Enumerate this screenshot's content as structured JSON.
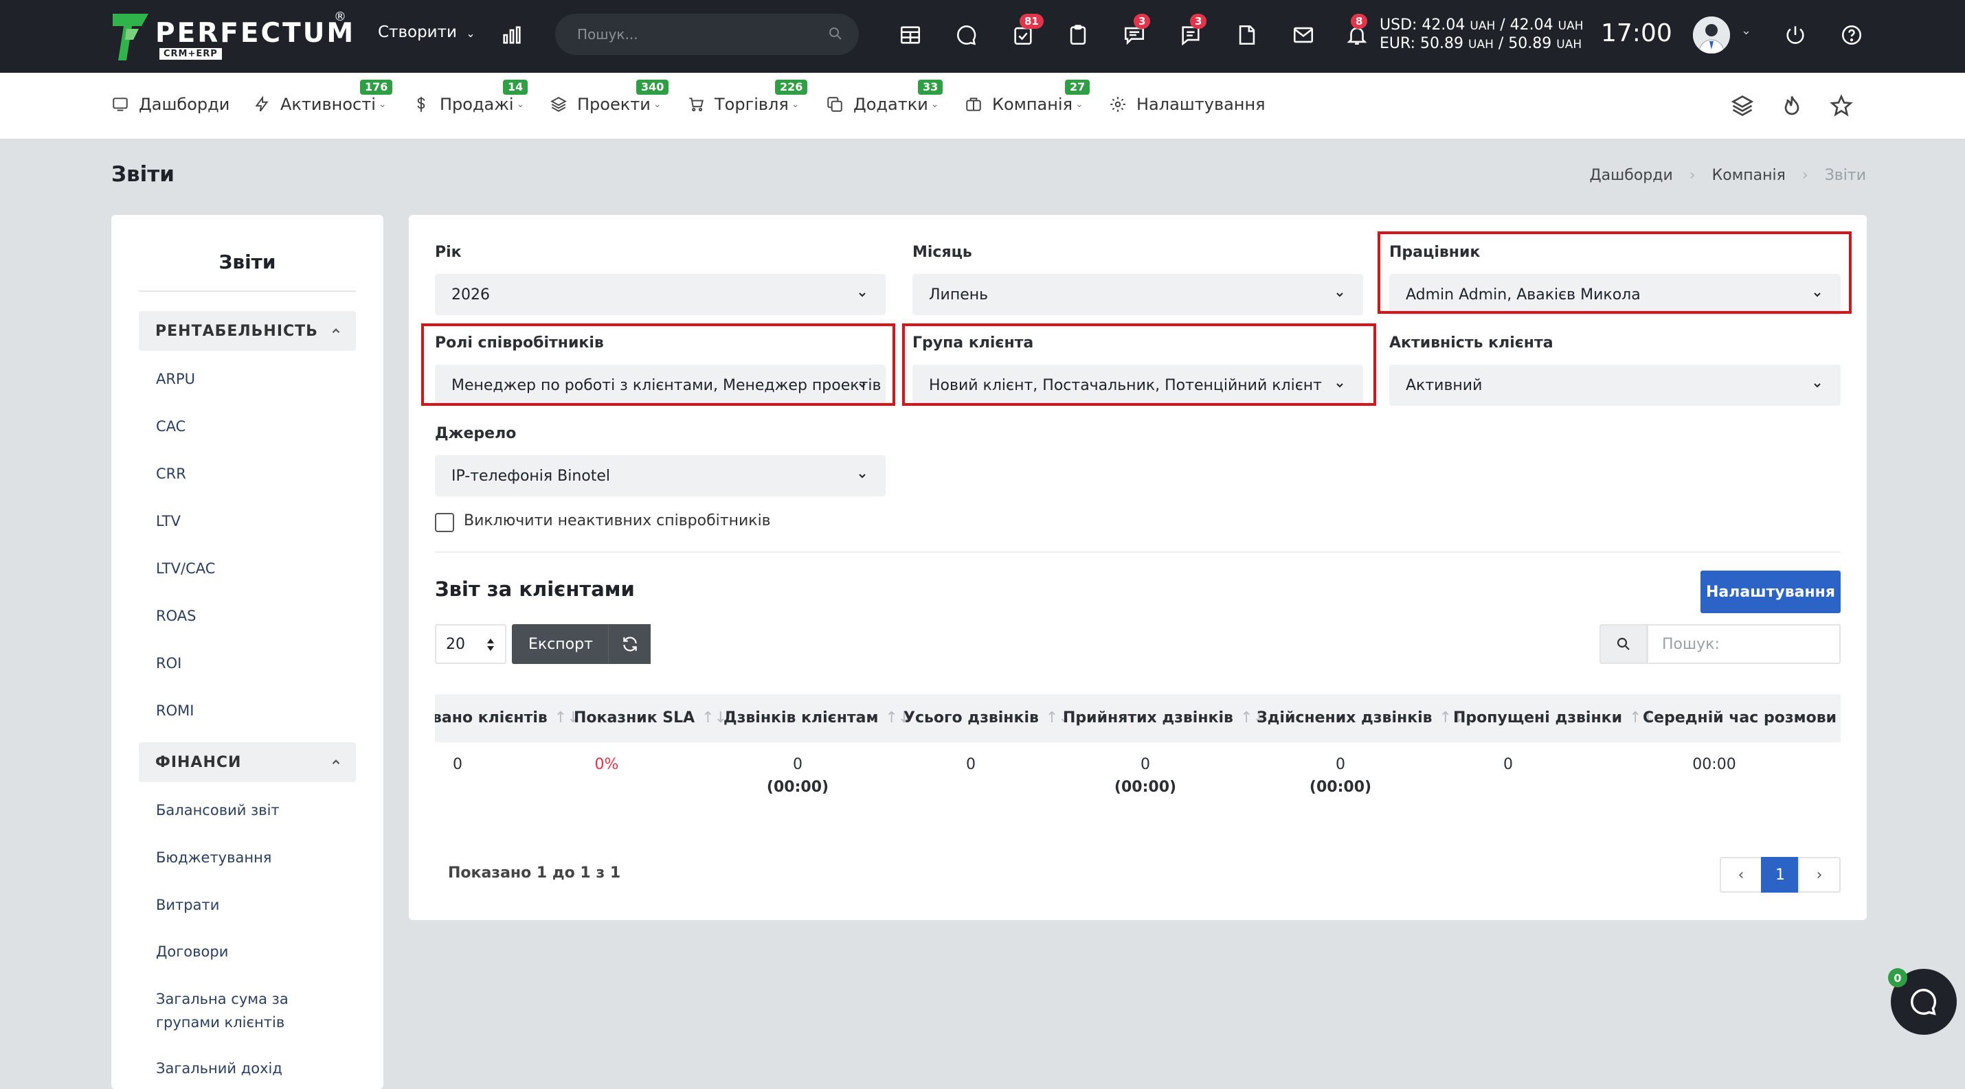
{
  "header": {
    "logo_text": "PERFECTUM",
    "logo_reg": "®",
    "logo_sub": "CRM+ERP",
    "create_label": "Створити",
    "search_placeholder": "Пошук...",
    "badges": {
      "tasks": "81",
      "chat": "3",
      "comments": "3",
      "notifications": "8"
    },
    "currency_usd": "USD: 42.04",
    "currency_usd_unit1": "UAH",
    "currency_usd_sep": " / 42.04",
    "currency_usd_unit2": "UAH",
    "currency_eur": "EUR: 50.89",
    "currency_eur_unit1": "UAH",
    "currency_eur_sep": " / 50.89",
    "currency_eur_unit2": "UAH",
    "clock": "17:00",
    "icons": [
      "bar-chart-icon",
      "calendar-grid-icon",
      "chat-bubble-icon",
      "task-check-icon",
      "clipboard-icon",
      "comments-icon",
      "message-icon",
      "document-icon",
      "mail-icon",
      "bell-icon",
      "power-icon",
      "help-icon"
    ]
  },
  "nav": {
    "items": [
      {
        "label": "Дашборди",
        "count": "",
        "icon": "dashboard-icon"
      },
      {
        "label": "Активності",
        "count": "176",
        "icon": "lightning-icon"
      },
      {
        "label": "Продажі",
        "count": "14",
        "icon": "dollar-icon"
      },
      {
        "label": "Проекти",
        "count": "340",
        "icon": "layers-icon"
      },
      {
        "label": "Торгівля",
        "count": "226",
        "icon": "cart-icon"
      },
      {
        "label": "Додатки",
        "count": "33",
        "icon": "copy-icon"
      },
      {
        "label": "Компанія",
        "count": "27",
        "icon": "briefcase-icon"
      },
      {
        "label": "Налаштування",
        "count": "",
        "icon": "gear-icon"
      }
    ]
  },
  "page": {
    "title": "Звіти",
    "breadcrumb": [
      "Дашборди",
      "Компанія",
      "Звіти"
    ]
  },
  "sidebar": {
    "title": "Звіти",
    "section1": "РЕНТАБЕЛЬНІСТЬ",
    "section1_items": [
      "ARPU",
      "CAC",
      "CRR",
      "LTV",
      "LTV/CAC",
      "ROAS",
      "ROI",
      "ROMI"
    ],
    "section2": "ФІНАНСИ",
    "section2_items": [
      "Балансовий звіт",
      "Бюджетування",
      "Витрати",
      "Договори",
      "Загальна сума за",
      "групами клієнтів",
      "Загальний дохід"
    ]
  },
  "filters": {
    "year_label": "Рік",
    "year_value": "2026",
    "month_label": "Місяць",
    "month_value": "Липень",
    "employee_label": "Працівник",
    "employee_value": "Admin Admin, Авакієв Микола",
    "roles_label": "Ролі співробітників",
    "roles_value": "Менеджер по роботі з клієнтами, Менеджер проектів",
    "group_label": "Група клієнта",
    "group_value": "Новий клієнт, Постачальник, Потенційний клієнт, Підрядник",
    "activity_label": "Активність клієнта",
    "activity_value": "Активний",
    "source_label": "Джерело",
    "source_value": "IP-телефонія Binotel",
    "exclude_inactive": "Виключити неактивних співробітників"
  },
  "report": {
    "title": "Звіт за клієнтами",
    "settings_button": "Налаштування",
    "page_size": "20",
    "export_button": "Експорт",
    "search_placeholder": "Пошук:",
    "columns": [
      "вано клієнтів",
      "Показник SLA",
      "Дзвінків клієнтам",
      "Усього дзвінків",
      "Прийнятих дзвінків",
      "Здійснених дзвінків",
      "Пропущені дзвінки",
      "Середній час розмови"
    ],
    "sort_glyph": "↑↓",
    "row": {
      "clients": "0",
      "sla": "0%",
      "calls_to_clients": "0",
      "calls_to_clients_time": "(00:00)",
      "total_calls": "0",
      "accepted_calls": "0",
      "accepted_calls_time": "(00:00)",
      "made_calls": "0",
      "made_calls_time": "(00:00)",
      "missed_calls": "0",
      "avg_talk": "00:00"
    },
    "showing": "Показано 1 до 1 з 1",
    "pagination": {
      "prev": "‹",
      "current": "1",
      "next": "›"
    }
  },
  "chat": {
    "count": "0"
  },
  "colors": {
    "topbar": "#1f2329",
    "accent": "#2b63c6",
    "highlight": "#d7141a",
    "nav_badge": "#2f9e44",
    "alert_badge": "#e0354a"
  }
}
